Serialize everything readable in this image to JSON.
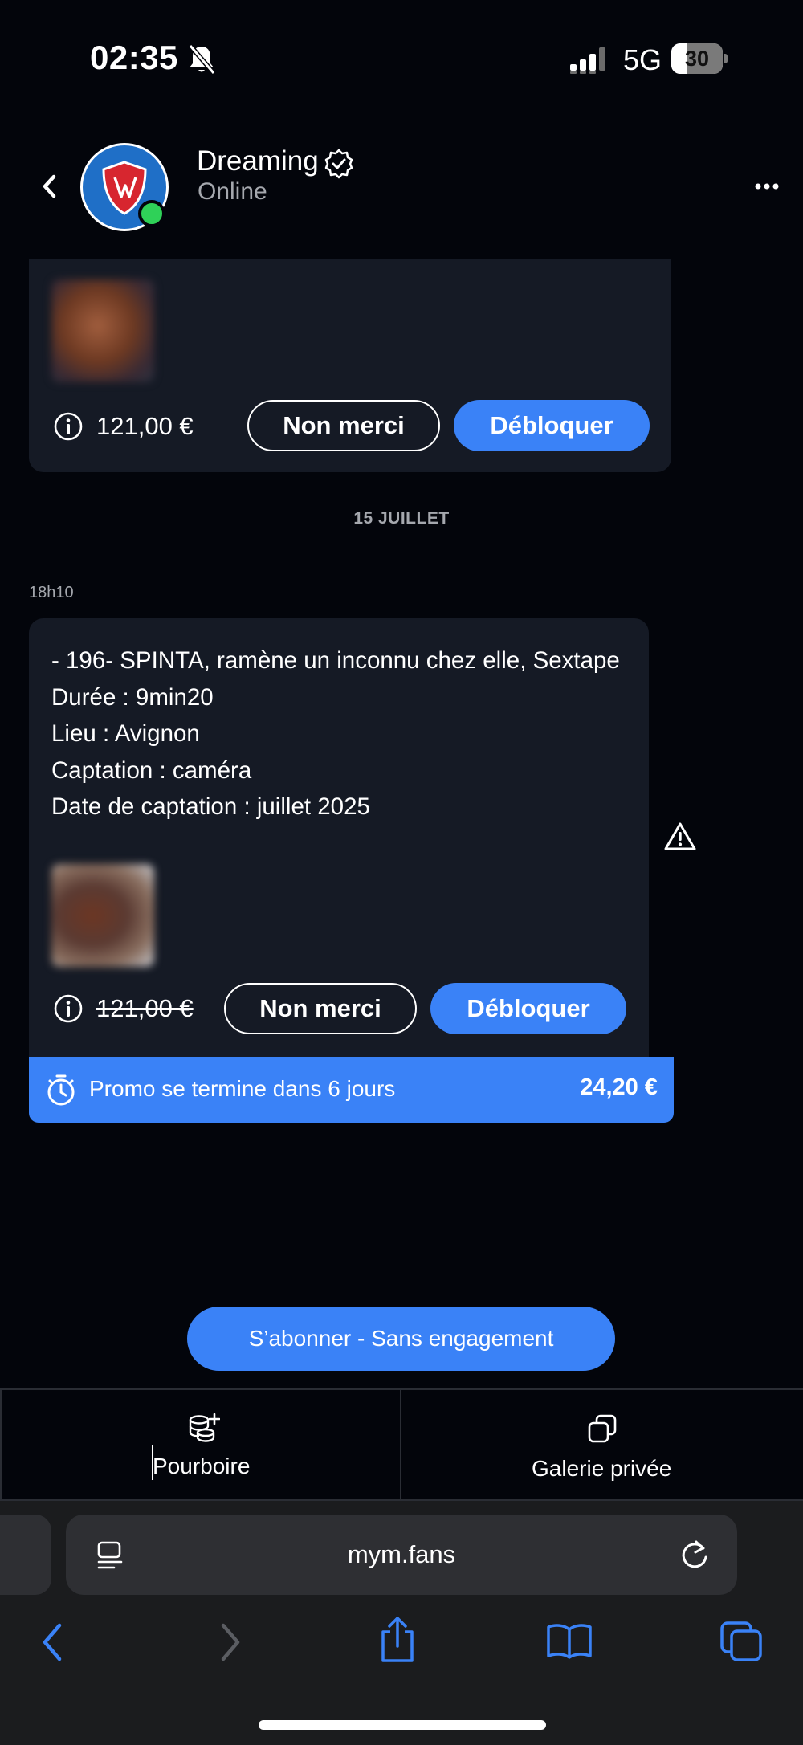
{
  "status_bar": {
    "time": "02:35",
    "network": "5G",
    "battery_level": "30"
  },
  "header": {
    "contact_name": "Dreaming",
    "contact_status": "Online"
  },
  "messages": [
    {
      "price": "121,00 €",
      "decline_label": "Non merci",
      "unlock_label": "Débloquer"
    },
    {
      "date_separator": "15 JUILLET",
      "time": "18h10",
      "lines": [
        "- 196- SPINTA, ramène un inconnu chez elle, Sextape",
        "Durée : 9min20",
        "Lieu : Avignon",
        "Captation : caméra",
        "Date de captation : juillet 2025"
      ],
      "original_price": "121,00 €",
      "decline_label": "Non merci",
      "unlock_label": "Débloquer",
      "promo_text": "Promo se termine dans 6 jours",
      "promo_price": "24,20 €"
    }
  ],
  "subscribe_label": "S’abonner - Sans engagement",
  "actions": {
    "tip_label": "Pourboire",
    "gallery_label": "Galerie privée"
  },
  "browser": {
    "url": "mym.fans"
  },
  "colors": {
    "accent": "#3a82f7",
    "background": "#03050b",
    "card": "#151a25",
    "online": "#2fd158"
  }
}
